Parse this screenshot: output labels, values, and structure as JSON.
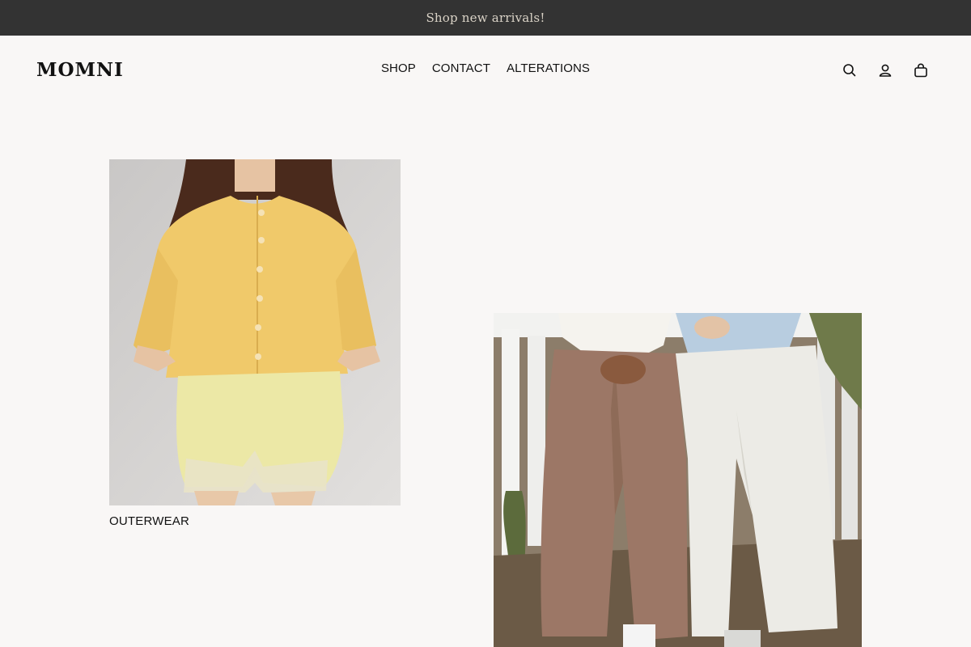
{
  "announcement": "Shop new arrivals!",
  "header": {
    "logo": "MOMNI",
    "nav": [
      "SHOP",
      "CONTACT",
      "ALTERATIONS"
    ],
    "icons": [
      "search-icon",
      "account-icon",
      "cart-icon"
    ]
  },
  "collections": [
    {
      "caption": "OUTERWEAR"
    }
  ],
  "colors": {
    "announcement_bg": "#333333",
    "page_bg": "#f9f7f6"
  }
}
